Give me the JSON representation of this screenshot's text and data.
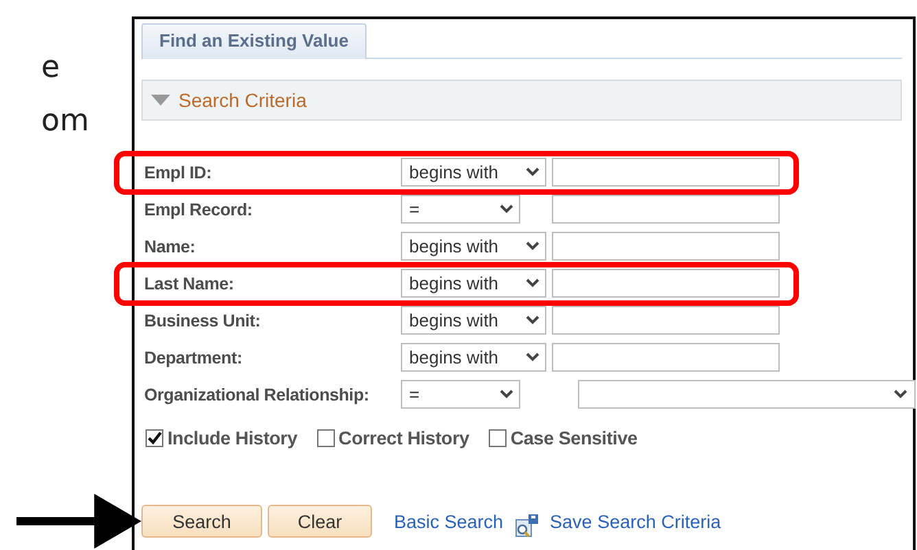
{
  "doc_text": [
    "e",
    "om"
  ],
  "tabs": [
    {
      "label": "Find an Existing Value",
      "selected": true
    }
  ],
  "section": {
    "title": "Search Criteria",
    "expanded": true
  },
  "fields": [
    {
      "label": "Empl ID:",
      "kind": "text",
      "operator": "begins with",
      "highlighted": true
    },
    {
      "label": "Empl Record:",
      "kind": "number",
      "operator": "=",
      "highlighted": false
    },
    {
      "label": "Name:",
      "kind": "text",
      "operator": "begins with",
      "highlighted": false
    },
    {
      "label": "Last Name:",
      "kind": "text",
      "operator": "begins with",
      "highlighted": true
    },
    {
      "label": "Business Unit:",
      "kind": "text",
      "operator": "begins with",
      "highlighted": false
    },
    {
      "label": "Department:",
      "kind": "text",
      "operator": "begins with",
      "highlighted": false
    },
    {
      "label": "Organizational Relationship:",
      "kind": "select",
      "operator": "=",
      "highlighted": false
    }
  ],
  "options": [
    {
      "label": "Include History",
      "checked": true
    },
    {
      "label": "Correct History",
      "checked": false
    },
    {
      "label": "Case Sensitive",
      "checked": false
    }
  ],
  "buttons": [
    {
      "label": "Search",
      "pointed": true
    },
    {
      "label": "Clear",
      "pointed": false
    }
  ],
  "links": [
    {
      "label": "Basic Search",
      "kind": "plain"
    },
    {
      "label": "Save Search Criteria",
      "kind": "save"
    }
  ]
}
